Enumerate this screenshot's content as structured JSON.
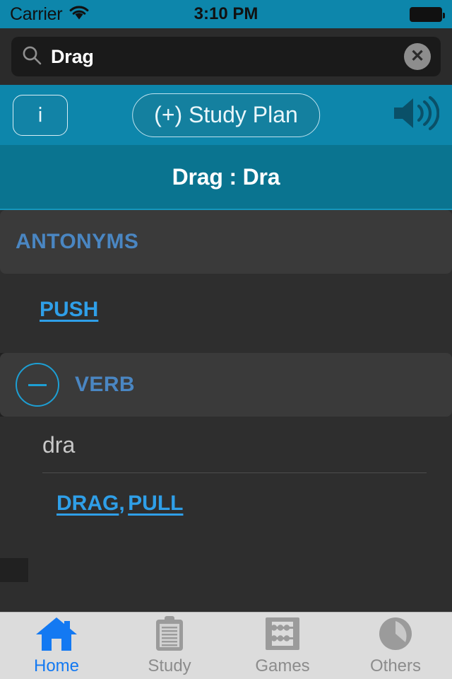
{
  "status_bar": {
    "carrier": "Carrier",
    "wifi_icon": "wifi-icon",
    "time": "3:10 PM",
    "battery_icon": "battery-full-icon"
  },
  "search": {
    "icon": "search-icon",
    "value": "Drag",
    "placeholder": "Search",
    "clear_icon": "clear-circle-icon",
    "clear_glyph": "✕"
  },
  "toolbar": {
    "info_label": "i",
    "study_plan_label": "(+) Study Plan",
    "speaker_icon": "speaker-volume-icon"
  },
  "title_bar": {
    "text": "Drag : Dra"
  },
  "sections": [
    {
      "type": "antonyms",
      "header": "ANTONYMS",
      "has_collapse_toggle": false,
      "links": [
        "PUSH"
      ]
    },
    {
      "type": "verb",
      "header": "VERB",
      "has_collapse_toggle": true,
      "collapse_icon": "minus-circle-icon",
      "definition": "dra",
      "links": [
        "DRAG",
        "PULL"
      ],
      "link_separator": ","
    }
  ],
  "tab_bar": {
    "tabs": [
      {
        "label": "Home",
        "icon": "home-icon",
        "active": true
      },
      {
        "label": "Study",
        "icon": "clipboard-icon",
        "active": false
      },
      {
        "label": "Games",
        "icon": "abacus-icon",
        "active": false
      },
      {
        "label": "Others",
        "icon": "pie-chart-icon",
        "active": false
      }
    ]
  },
  "colors": {
    "teal_bar": "#0d86ab",
    "teal_title": "#0a7490",
    "page_bg": "#2e2e2e",
    "card_bg": "#3a3a3a",
    "link_blue": "#2f9fe8",
    "header_blue": "#4a86c2",
    "accent_blue": "#1d9fd4",
    "tab_active": "#1379f2",
    "tab_inactive": "#8c8c8c",
    "tabbar_bg": "#dcdcdc"
  }
}
